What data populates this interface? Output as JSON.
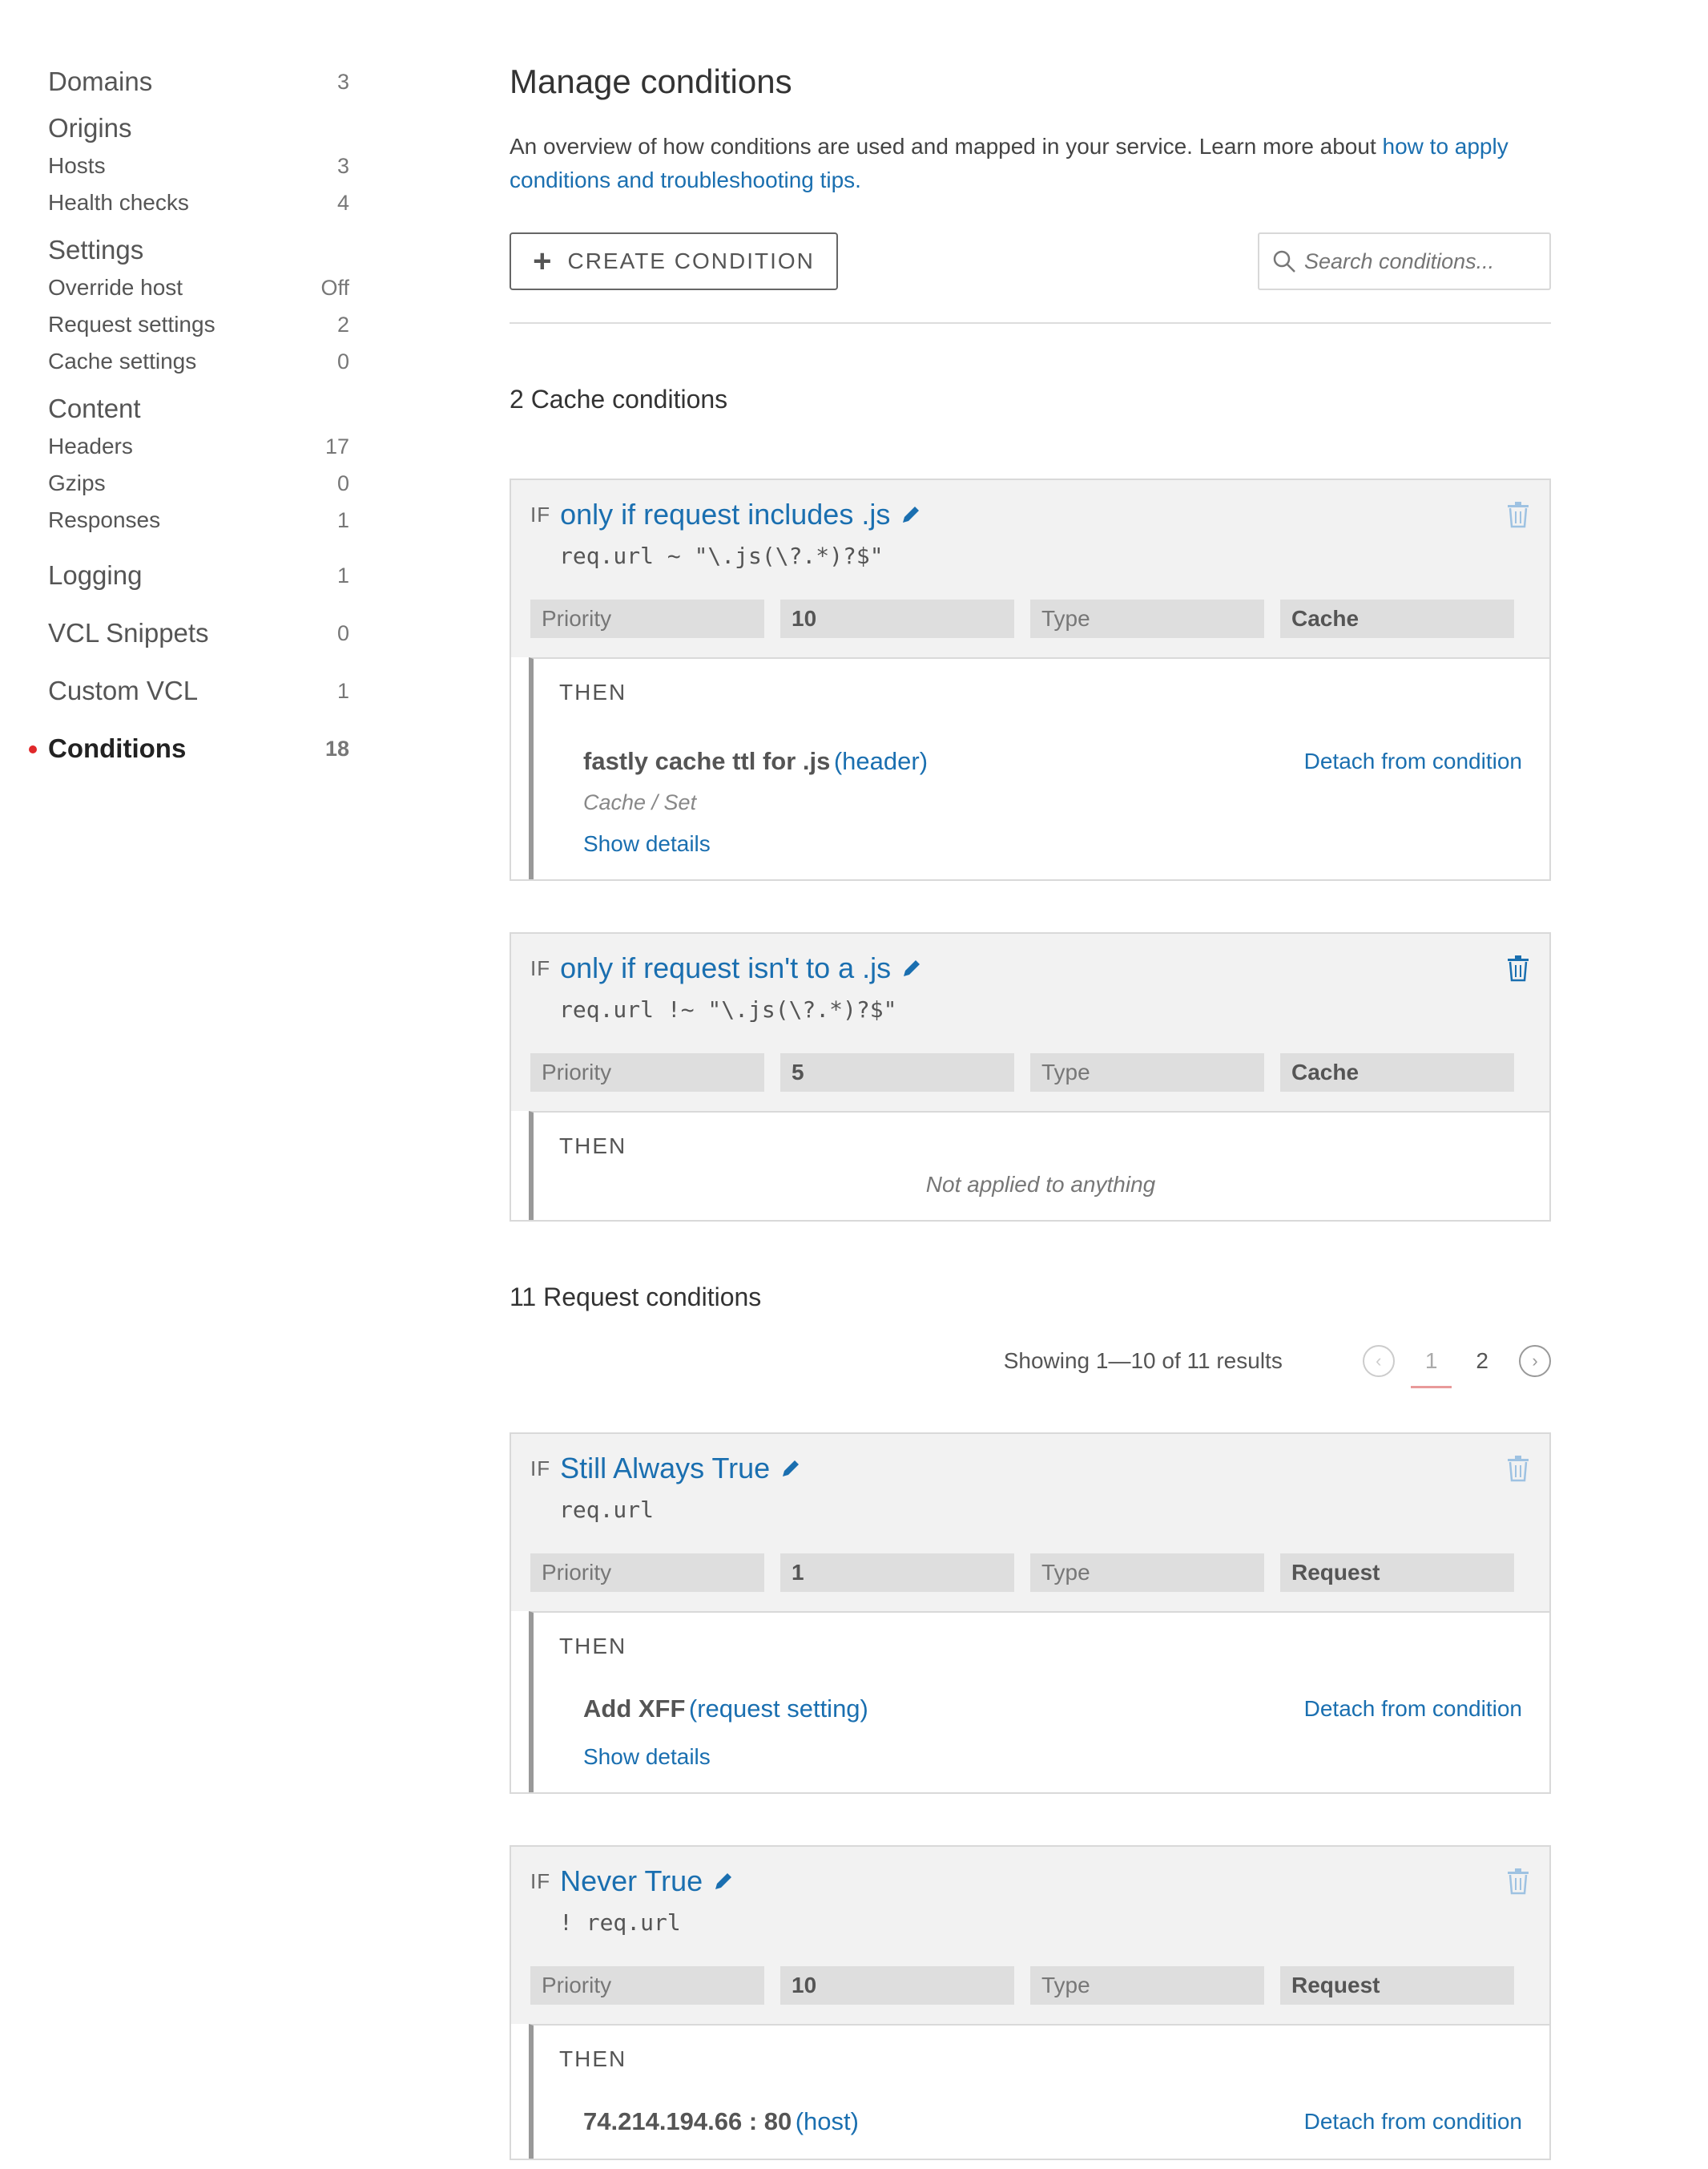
{
  "sidebar": {
    "items": [
      {
        "label": "Domains",
        "count": "3",
        "kind": "group"
      },
      {
        "label": "Origins",
        "count": "",
        "kind": "group"
      },
      {
        "label": "Hosts",
        "count": "3",
        "kind": "item"
      },
      {
        "label": "Health checks",
        "count": "4",
        "kind": "item"
      },
      {
        "label": "Settings",
        "count": "",
        "kind": "group"
      },
      {
        "label": "Override host",
        "count": "Off",
        "kind": "item"
      },
      {
        "label": "Request settings",
        "count": "2",
        "kind": "item"
      },
      {
        "label": "Cache settings",
        "count": "0",
        "kind": "item"
      },
      {
        "label": "Content",
        "count": "",
        "kind": "group"
      },
      {
        "label": "Headers",
        "count": "17",
        "kind": "item"
      },
      {
        "label": "Gzips",
        "count": "0",
        "kind": "item"
      },
      {
        "label": "Responses",
        "count": "1",
        "kind": "item"
      },
      {
        "label": "Logging",
        "count": "1",
        "kind": "group"
      },
      {
        "label": "VCL Snippets",
        "count": "0",
        "kind": "group"
      },
      {
        "label": "Custom VCL",
        "count": "1",
        "kind": "group"
      },
      {
        "label": "Conditions",
        "count": "18",
        "kind": "group",
        "active": true
      }
    ]
  },
  "main": {
    "title": "Manage conditions",
    "intro_text": "An overview of how conditions are used and mapped in your service. Learn more about ",
    "intro_link": "how to apply conditions and troubleshooting tips.",
    "create_label": "CREATE CONDITION",
    "search_placeholder": "Search conditions..."
  },
  "cache_section": {
    "title": "2 Cache conditions",
    "conditions": [
      {
        "if_label": "IF",
        "name": "only if request includes .js",
        "expression": "req.url ~ \"\\.js(\\?.*)?$\"",
        "priority_label": "Priority",
        "priority": "10",
        "type_label": "Type",
        "type": "Cache",
        "then_label": "THEN",
        "action_name": "fastly cache ttl for .js",
        "action_type": "(header)",
        "action_sub": "Cache / Set",
        "detach_label": "Detach from condition",
        "show_details": "Show details"
      },
      {
        "if_label": "IF",
        "name": "only if request isn't to a .js",
        "expression": "req.url !~ \"\\.js(\\?.*)?$\"",
        "priority_label": "Priority",
        "priority": "5",
        "type_label": "Type",
        "type": "Cache",
        "then_label": "THEN",
        "not_applied": "Not applied to anything"
      }
    ]
  },
  "request_section": {
    "title": "11 Request conditions",
    "pager_text": "Showing 1—10 of 11 results",
    "pages": [
      "1",
      "2"
    ],
    "conditions": [
      {
        "if_label": "IF",
        "name": "Still Always True",
        "expression": "req.url",
        "priority_label": "Priority",
        "priority": "1",
        "type_label": "Type",
        "type": "Request",
        "then_label": "THEN",
        "action_name": "Add XFF",
        "action_type": "(request setting)",
        "detach_label": "Detach from condition",
        "show_details": "Show details"
      },
      {
        "if_label": "IF",
        "name": "Never True",
        "expression": "! req.url",
        "priority_label": "Priority",
        "priority": "10",
        "type_label": "Type",
        "type": "Request",
        "then_label": "THEN",
        "action_name": "74.214.194.66 : 80",
        "action_type": "(host)",
        "detach_label": "Detach from condition"
      }
    ]
  },
  "icons": {
    "create": "plus-icon",
    "search": "search-icon",
    "edit": "pencil-icon",
    "delete": "trash-icon",
    "prev": "chevron-left-icon",
    "next": "chevron-right-icon"
  },
  "colors": {
    "link": "#1a6fb0",
    "active_dot": "#e0282a",
    "card_bg": "#f2f2f2",
    "meta_bg": "#dedede"
  }
}
